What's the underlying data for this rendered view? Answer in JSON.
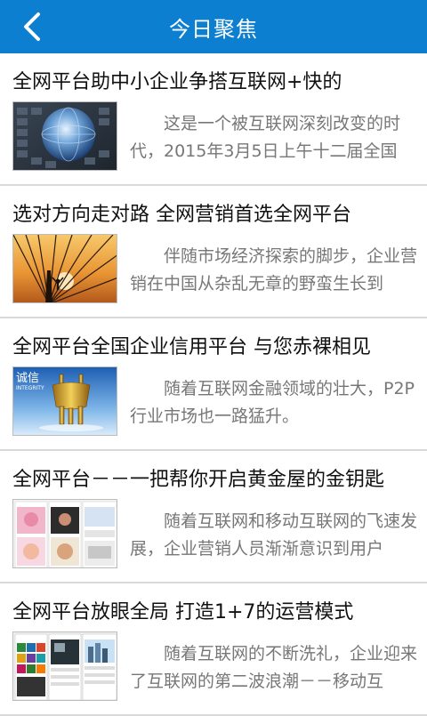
{
  "header": {
    "title": "今日聚焦",
    "back_icon": "chevron-left-icon"
  },
  "colors": {
    "header_bg": "#0d7fd1",
    "summary_text": "#777777",
    "divider": "#d9d9d9"
  },
  "articles": [
    {
      "title": "全网平台助中小企业争搭互联网+快的",
      "summary": "这是一个被互联网深刻改变的时代，2015年3月5日上午十二届全国",
      "thumb": "globe-keyboard-image"
    },
    {
      "title": "选对方向走对路 全网营销首选全网平台",
      "summary": "伴随市场经济探索的脚步，企业营销在中国从杂乱无章的野蛮生长到",
      "thumb": "sunset-bridge-image"
    },
    {
      "title": "全网平台全国企业信用平台 与您赤裸相见",
      "summary": "随着互联网金融领域的壮大，P2P行业市场也一路猛升。",
      "thumb": "integrity-bronze-vessel-image",
      "thumb_text_cn": "诚信",
      "thumb_text_en": "INTEGRITY"
    },
    {
      "title": "全网平台－－一把帮你开启黄金屋的金钥匙",
      "summary": "随着互联网和移动互联网的飞速发展，企业营销人员渐渐意识到用户",
      "thumb": "website-collage-image"
    },
    {
      "title": "全网平台放眼全局 打造1+7的运营模式",
      "summary": "随着互联网的不断洗礼，企业迎来了互联网的第二波浪潮－－移动互",
      "thumb": "mobile-app-screens-image"
    }
  ]
}
